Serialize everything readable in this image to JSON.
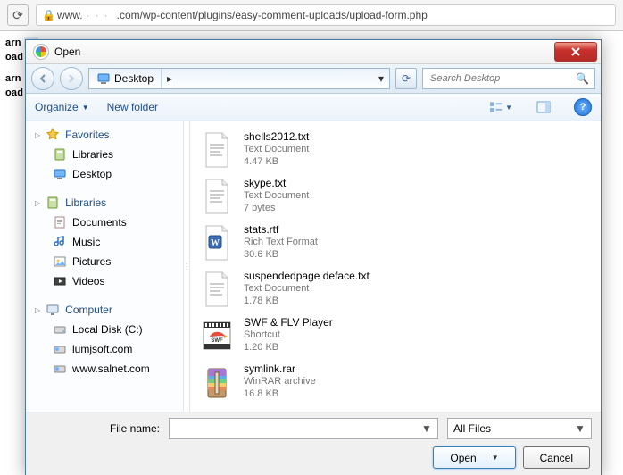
{
  "browser": {
    "url_prefix": "www.",
    "url_suffix": ".com/wp-content/plugins/easy-comment-uploads/upload-form.php"
  },
  "bg_lines": [
    "arn",
    "oad",
    "arn",
    "oad"
  ],
  "dialog": {
    "title": "Open",
    "nav": {
      "location": "Desktop",
      "search_placeholder": "Search Desktop"
    },
    "toolbar": {
      "organize": "Organize",
      "newfolder": "New folder"
    },
    "sidebar": {
      "groups": [
        {
          "head": "Favorites",
          "icon": "star",
          "items": [
            {
              "label": "Libraries",
              "icon": "libraries"
            },
            {
              "label": "Desktop",
              "icon": "desktop"
            }
          ]
        },
        {
          "head": "Libraries",
          "icon": "libraries",
          "items": [
            {
              "label": "Documents",
              "icon": "doc"
            },
            {
              "label": "Music",
              "icon": "music"
            },
            {
              "label": "Pictures",
              "icon": "pic"
            },
            {
              "label": "Videos",
              "icon": "vid"
            }
          ]
        },
        {
          "head": "Computer",
          "icon": "computer",
          "items": [
            {
              "label": "Local Disk (C:)",
              "icon": "hdd"
            },
            {
              "label": "lumjsoft.com",
              "icon": "net"
            },
            {
              "label": "www.salnet.com",
              "icon": "net"
            }
          ]
        }
      ]
    },
    "files": [
      {
        "name": "shells2012.txt",
        "kind": "Text Document",
        "size": "4.47 KB",
        "icon": "txt"
      },
      {
        "name": "skype.txt",
        "kind": "Text Document",
        "size": "7 bytes",
        "icon": "txt"
      },
      {
        "name": "stats.rtf",
        "kind": "Rich Text Format",
        "size": "30.6 KB",
        "icon": "rtf"
      },
      {
        "name": "suspendedpage deface.txt",
        "kind": "Text Document",
        "size": "1.78 KB",
        "icon": "txt"
      },
      {
        "name": "SWF & FLV Player",
        "kind": "Shortcut",
        "size": "1.20 KB",
        "icon": "swf"
      },
      {
        "name": "symlink.rar",
        "kind": "WinRAR archive",
        "size": "16.8 KB",
        "icon": "rar"
      }
    ],
    "footer": {
      "filename_label": "File name:",
      "filename_value": "",
      "filter": "All Files",
      "open": "Open",
      "cancel": "Cancel"
    }
  }
}
